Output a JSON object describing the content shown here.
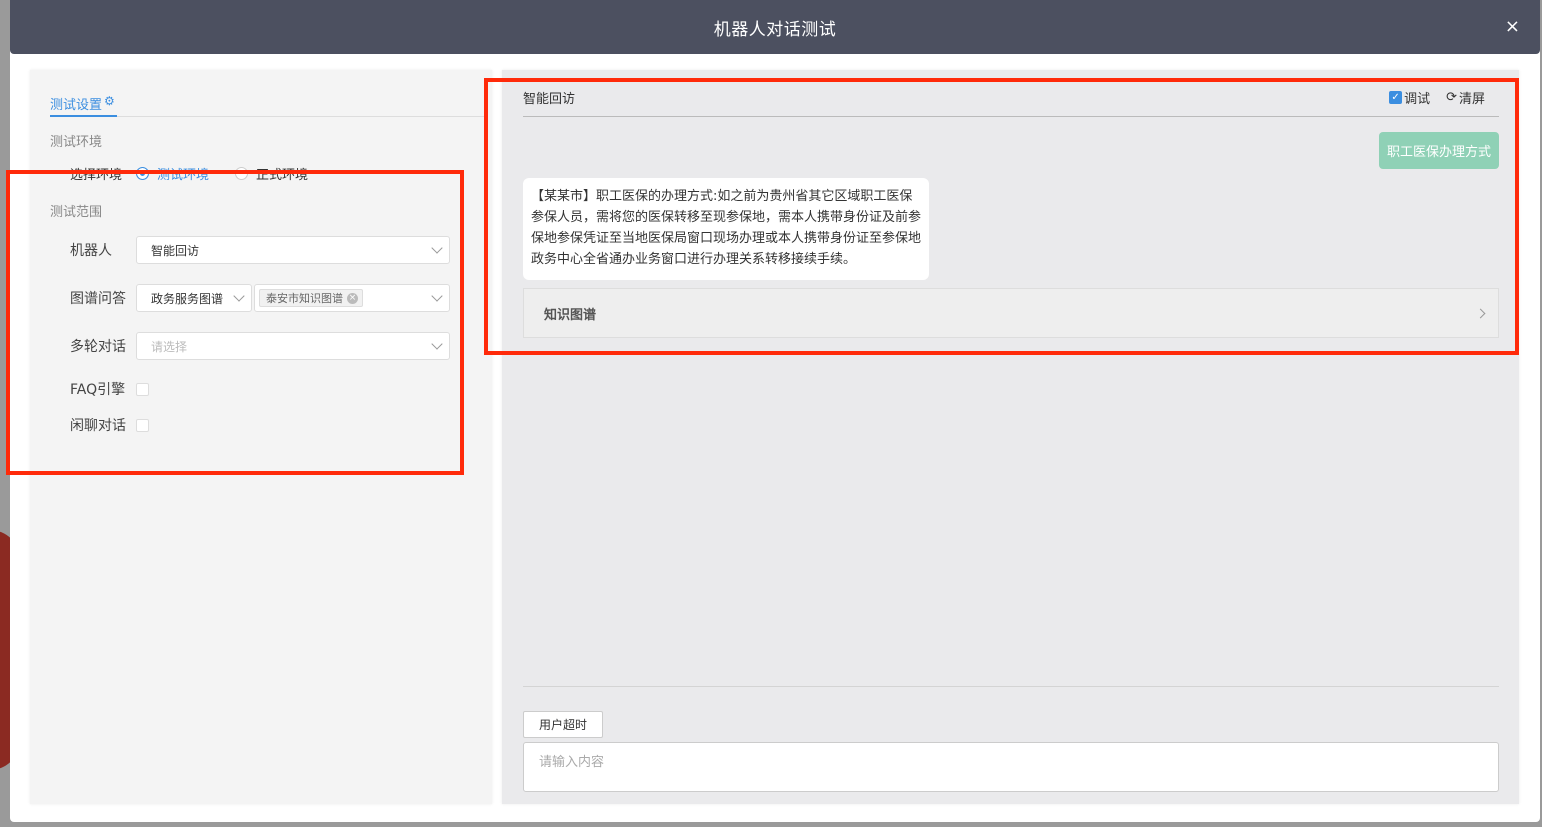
{
  "dialog": {
    "title": "机器人对话测试",
    "close_label": "×"
  },
  "left": {
    "tab_label": "测试设置",
    "tab_icon": "gear-icon",
    "section_env": "测试环境",
    "env_label": "选择环境",
    "env_options": [
      "测试环境",
      "正式环境"
    ],
    "env_selected": "测试环境",
    "section_scope": "测试范围",
    "robot_label": "机器人",
    "robot_value": "智能回访",
    "kg_label": "图谱问答",
    "kg_type_value": "政务服务图谱",
    "kg_tag": "泰安市知识图谱",
    "multi_label": "多轮对话",
    "multi_placeholder": "请选择",
    "faq_label": "FAQ引擎",
    "chat_label": "闲聊对话"
  },
  "right": {
    "title": "智能回访",
    "debug_label": "调试",
    "debug_checked": true,
    "clear_label": "清屏",
    "user_message": "职工医保办理方式",
    "bot_message": "【某某市】职工医保的办理方式:如之前为贵州省其它区域职工医保参保人员，需将您的医保转移至现参保地，需本人携带身份证及前参保地参保凭证至当地医保局窗口现场办理或本人携带身份证至参保地政务中心全省通办业务窗口进行办理关系转移接续手续。",
    "kg_card_title": "知识图谱",
    "timeout_button": "用户超时",
    "input_placeholder": "请输入内容"
  },
  "colors": {
    "titlebar": "#4c5060",
    "accent": "#3b8ee0",
    "user_bubble": "#8fd1b6",
    "highlight": "#ff2a0a"
  }
}
